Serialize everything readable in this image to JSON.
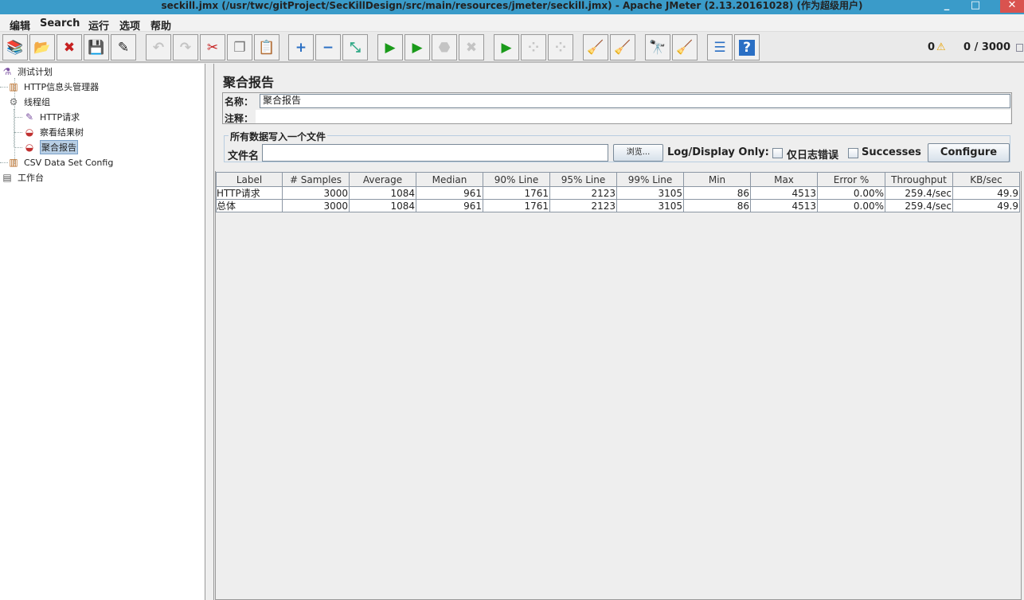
{
  "window": {
    "title": "seckill.jmx (/usr/twc/gitProject/SecKillDesign/src/main/resources/jmeter/seckill.jmx) - Apache JMeter (2.13.20161028) (作为超级用户)",
    "minimize": "_",
    "maximize": "□",
    "close": "✕"
  },
  "menu": [
    "编辑",
    "Search",
    "运行",
    "选项",
    "帮助"
  ],
  "toolbar": {
    "buttons": [
      {
        "name": "templates",
        "glyph": "📚",
        "enabled": true
      },
      {
        "name": "open",
        "glyph": "📂",
        "enabled": true
      },
      {
        "name": "close",
        "glyph": "✖",
        "enabled": true
      },
      {
        "name": "save",
        "glyph": "💾",
        "enabled": true
      },
      {
        "name": "save-as",
        "glyph": "✎",
        "enabled": true
      },
      {
        "name": "undo",
        "glyph": "↶",
        "enabled": false
      },
      {
        "name": "redo",
        "glyph": "↷",
        "enabled": false
      },
      {
        "name": "cut",
        "glyph": "✂",
        "enabled": true
      },
      {
        "name": "copy",
        "glyph": "❐",
        "enabled": true
      },
      {
        "name": "paste",
        "glyph": "📋",
        "enabled": true
      },
      {
        "name": "expand",
        "glyph": "+",
        "enabled": true
      },
      {
        "name": "collapse",
        "glyph": "−",
        "enabled": true
      },
      {
        "name": "toggle",
        "glyph": "⤡",
        "enabled": true
      },
      {
        "name": "start",
        "glyph": "▶",
        "enabled": true
      },
      {
        "name": "start-no-pause",
        "glyph": "▶",
        "enabled": true
      },
      {
        "name": "stop",
        "glyph": "⬣",
        "enabled": false
      },
      {
        "name": "shutdown",
        "glyph": "✖",
        "enabled": false
      },
      {
        "name": "remote-start",
        "glyph": "▶",
        "enabled": true
      },
      {
        "name": "remote-stop",
        "glyph": "⁘",
        "enabled": false
      },
      {
        "name": "remote-shutdown",
        "glyph": "⁘",
        "enabled": false
      },
      {
        "name": "clear",
        "glyph": "🧹",
        "enabled": true
      },
      {
        "name": "clear-all",
        "glyph": "🧹",
        "enabled": true
      },
      {
        "name": "search",
        "glyph": "🔭",
        "enabled": true
      },
      {
        "name": "reset-search",
        "glyph": "🧹",
        "enabled": true
      },
      {
        "name": "function-helper",
        "glyph": "☰",
        "enabled": true
      },
      {
        "name": "help",
        "glyph": "?",
        "enabled": true
      }
    ],
    "error_count": "0",
    "warning_icon": "⚠",
    "threads": "0 / 3000"
  },
  "tree": [
    {
      "label": "测试计划",
      "icon": "⚗"
    },
    {
      "label": "HTTP信息头管理器",
      "icon": "▥"
    },
    {
      "label": "线程组",
      "icon": "⚙"
    },
    {
      "label": "HTTP请求",
      "icon": "✎"
    },
    {
      "label": "察看结果树",
      "icon": "◒"
    },
    {
      "label": "聚合报告",
      "icon": "◒"
    },
    {
      "label": "CSV Data Set Config",
      "icon": "▥"
    },
    {
      "label": "工作台",
      "icon": "▤"
    }
  ],
  "panel": {
    "title": "聚合报告",
    "name_label": "名称：",
    "name_value": "聚合报告",
    "comment_label": "注释：",
    "comment_value": "",
    "file_group": "所有数据写入一个文件",
    "file_label": "文件名",
    "file_value": "",
    "browse": "浏览...",
    "log_label": "Log/Display Only:",
    "errors_only": "仅日志错误",
    "successes": "Successes",
    "configure": "Configure"
  },
  "table": {
    "headers": [
      "Label",
      "# Samples",
      "Average",
      "Median",
      "90% Line",
      "95% Line",
      "99% Line",
      "Min",
      "Max",
      "Error %",
      "Throughput",
      "KB/sec"
    ],
    "rows": [
      [
        "HTTP请求",
        "3000",
        "1084",
        "961",
        "1761",
        "2123",
        "3105",
        "86",
        "4513",
        "0.00%",
        "259.4/sec",
        "49.9"
      ],
      [
        "总体",
        "3000",
        "1084",
        "961",
        "1761",
        "2123",
        "3105",
        "86",
        "4513",
        "0.00%",
        "259.4/sec",
        "49.9"
      ]
    ]
  }
}
